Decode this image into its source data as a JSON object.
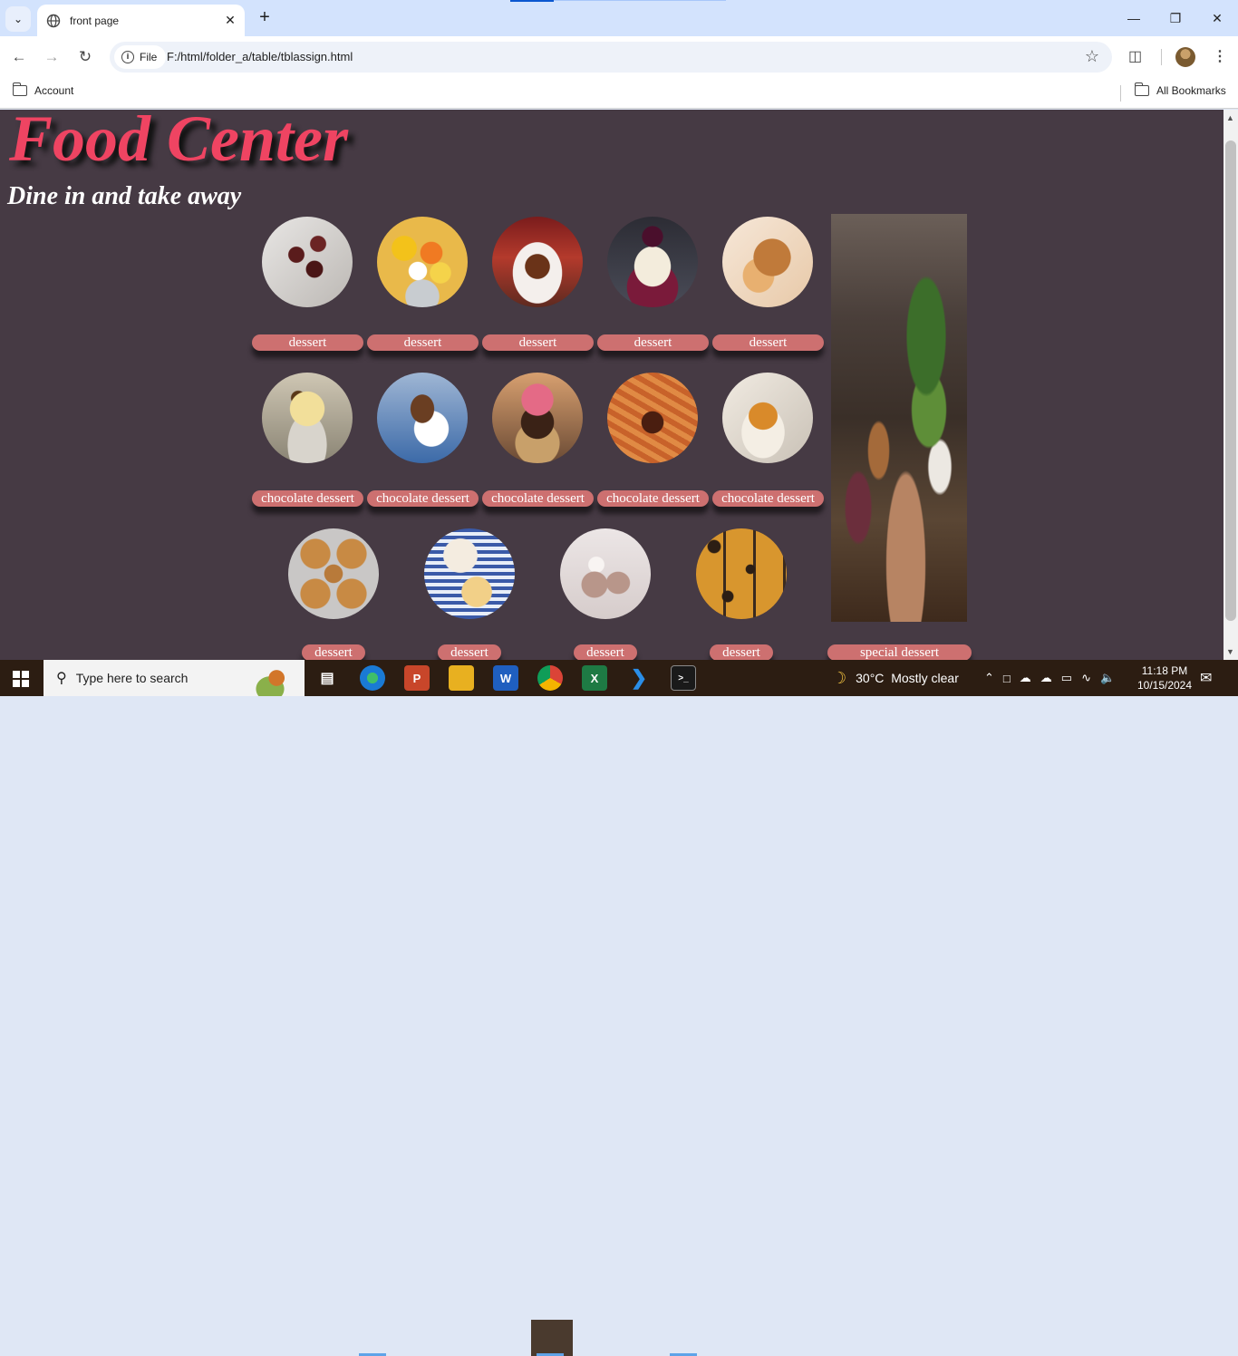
{
  "browser": {
    "tab_title": "front page",
    "url_scheme_chip": "File",
    "url": "F:/html/folder_a/table/tblassign.html",
    "bookmarks": {
      "left": "Account",
      "right": "All Bookmarks"
    }
  },
  "page": {
    "heading": "Food Center",
    "subheading": "Dine in and take away",
    "row1_labels": [
      "dessert",
      "dessert",
      "dessert",
      "dessert",
      "dessert"
    ],
    "row2_labels": [
      "chocolate dessert",
      "chocolate dessert",
      "chocolate dessert",
      "chocolate dessert",
      "chocolate dessert"
    ],
    "row3_labels": [
      "dessert",
      "dessert",
      "dessert",
      "dessert"
    ],
    "special_label": "special dessert",
    "colors": {
      "heading": "#ef4462",
      "background": "#463a44",
      "label_bg": "#cd7070"
    }
  },
  "taskbar": {
    "search_placeholder": "Type here to search",
    "weather": "30°C  Mostly clear",
    "time": "11:18 PM",
    "date": "10/15/2024"
  }
}
